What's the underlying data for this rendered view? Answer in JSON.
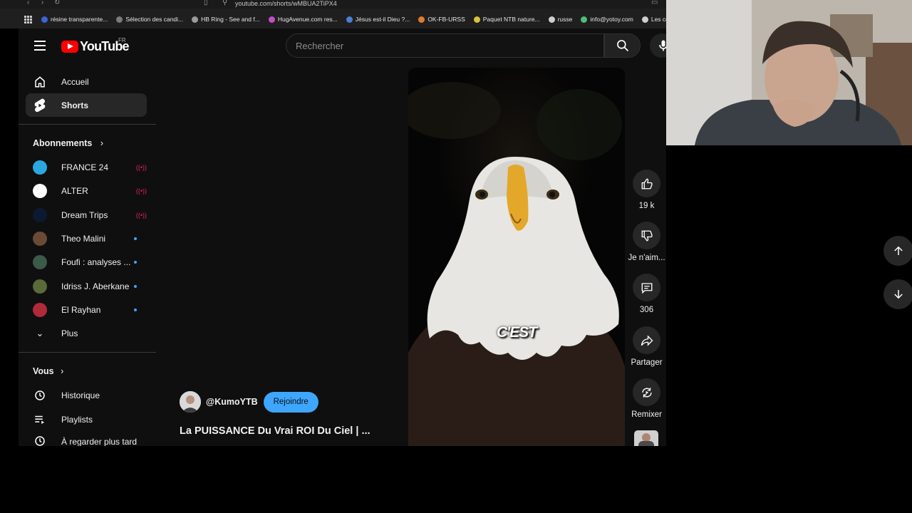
{
  "browser": {
    "url": "youtube.com/shorts/wMBUA2TiPX4",
    "bookmarks": [
      {
        "label": "résine transparente...",
        "color": "#3a66d6"
      },
      {
        "label": "Sélection des candi...",
        "color": "#7b7b7b"
      },
      {
        "label": "HB Ring - See and f...",
        "color": "#9b9b9b"
      },
      {
        "label": "HugAvenue.com res...",
        "color": "#c24ec7"
      },
      {
        "label": "Jésus est-il Dieu ?...",
        "color": "#4a7fd6"
      },
      {
        "label": "OK-FB-URSS",
        "color": "#e07b2c"
      },
      {
        "label": "Paquet NTB nature...",
        "color": "#d9c23a"
      },
      {
        "label": "russe",
        "color": "#cfcfcf"
      },
      {
        "label": "info@yotoy.com",
        "color": "#4dbf7a"
      },
      {
        "label": "Les concou",
        "color": "#cfcfcf"
      }
    ]
  },
  "header": {
    "logo_text": "YouTube",
    "country_code": "FR",
    "search_placeholder": "Rechercher"
  },
  "sidebar": {
    "main": [
      {
        "label": "Accueil",
        "icon": "home-icon"
      },
      {
        "label": "Shorts",
        "icon": "shorts-icon",
        "active": true
      }
    ],
    "subscriptions_title": "Abonnements",
    "subscriptions": [
      {
        "label": "FRANCE 24",
        "status": "live",
        "avatar_color": "#2aa8e0"
      },
      {
        "label": "ALTER",
        "status": "live",
        "avatar_color": "#ffffff"
      },
      {
        "label": "Dream Trips",
        "status": "live",
        "avatar_color": "#0b1a33"
      },
      {
        "label": "Theo Malini",
        "status": "new",
        "avatar_color": "#6b4a35"
      },
      {
        "label": "Foufi : analyses ...",
        "status": "new",
        "avatar_color": "#3b5a4a"
      },
      {
        "label": "Idriss J. Aberkane",
        "status": "new",
        "avatar_color": "#5a6a3a"
      },
      {
        "label": "El Rayhan",
        "status": "new",
        "avatar_color": "#b02a3a"
      }
    ],
    "more_label": "Plus",
    "you_title": "Vous",
    "you_items": [
      {
        "label": "Historique",
        "icon": "history-icon"
      },
      {
        "label": "Playlists",
        "icon": "playlist-icon"
      },
      {
        "label": "À regarder plus tard",
        "icon": "watch-later-icon"
      }
    ]
  },
  "short": {
    "caption": "C'EST",
    "channel_handle": "@KumoYTB",
    "join_label": "Rejoindre",
    "title": "La PUISSANCE Du Vrai ROI Du Ciel | ..."
  },
  "actions": {
    "like_count": "19 k",
    "dislike_label": "Je n'aim...",
    "comment_count": "306",
    "share_label": "Partager",
    "remix_label": "Remixer"
  }
}
